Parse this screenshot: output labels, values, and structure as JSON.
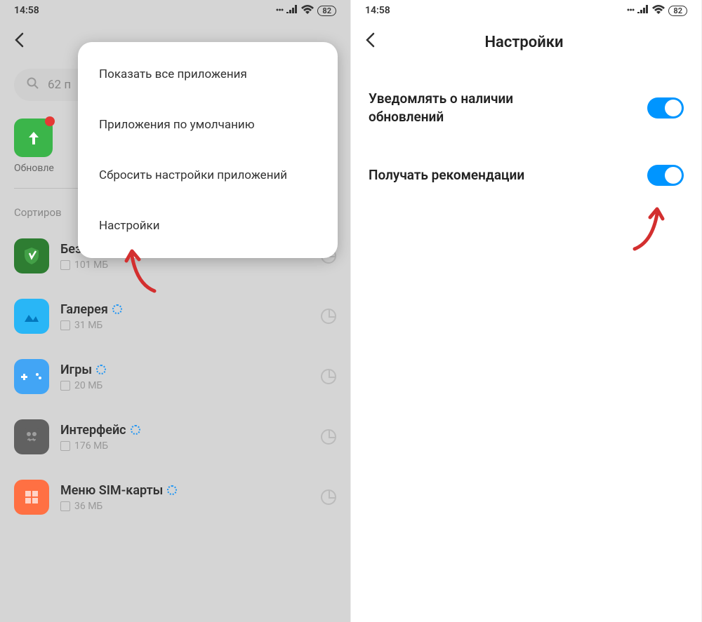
{
  "statusbar": {
    "time": "14:58",
    "battery": "82"
  },
  "left": {
    "search_text": "62 п",
    "update_label": "Обновле",
    "sort_label": "Сортиров",
    "apps": [
      {
        "name": "Безопасность",
        "size": "101 МБ",
        "icon": "security"
      },
      {
        "name": "Галерея",
        "size": "31 МБ",
        "icon": "gallery"
      },
      {
        "name": "Игры",
        "size": "20 МБ",
        "icon": "games"
      },
      {
        "name": "Интерфейс",
        "size": "176 МБ",
        "icon": "interface"
      },
      {
        "name": "Меню SIM-карты",
        "size": "36 МБ",
        "icon": "sim"
      }
    ],
    "popup": [
      "Показать все приложения",
      "Приложения по умолчанию",
      "Сбросить настройки приложений",
      "Настройки"
    ]
  },
  "right": {
    "title": "Настройки",
    "settings": [
      {
        "label": "Уведомлять о наличии обновлений",
        "on": true
      },
      {
        "label": "Получать рекомендации",
        "on": true
      }
    ]
  }
}
